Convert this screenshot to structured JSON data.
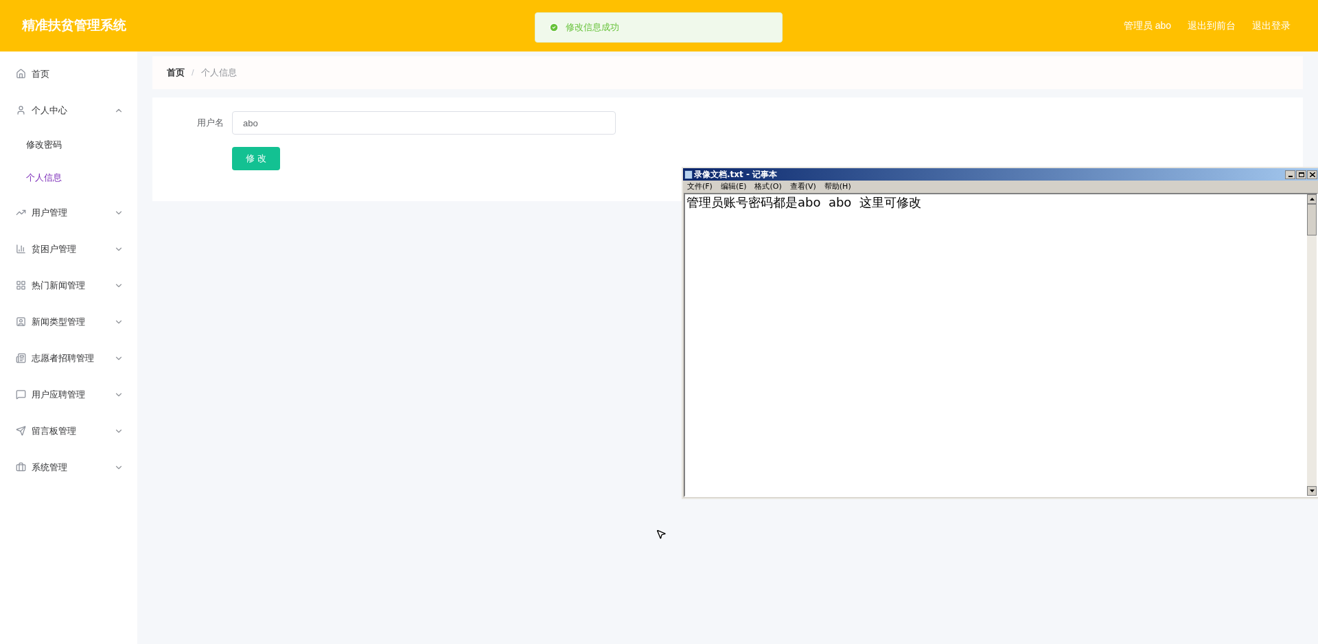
{
  "header": {
    "title": "精准扶贫管理系统",
    "links": [
      {
        "label": "管理员 abo"
      },
      {
        "label": "退出到前台"
      },
      {
        "label": "退出登录"
      }
    ]
  },
  "toast": {
    "message": "修改信息成功"
  },
  "sidebar": {
    "items": [
      {
        "label": "首页",
        "kind": "item"
      },
      {
        "label": "个人中心",
        "kind": "group",
        "expanded": true,
        "children": [
          {
            "label": "修改密码",
            "selected": false
          },
          {
            "label": "个人信息",
            "selected": true
          }
        ]
      },
      {
        "label": "用户管理",
        "kind": "group",
        "expanded": false
      },
      {
        "label": "贫困户管理",
        "kind": "group",
        "expanded": false
      },
      {
        "label": "热门新闻管理",
        "kind": "group",
        "expanded": false
      },
      {
        "label": "新闻类型管理",
        "kind": "group",
        "expanded": false
      },
      {
        "label": "志愿者招聘管理",
        "kind": "group",
        "expanded": false
      },
      {
        "label": "用户应聘管理",
        "kind": "group",
        "expanded": false
      },
      {
        "label": "留言板管理",
        "kind": "group",
        "expanded": false
      },
      {
        "label": "系统管理",
        "kind": "group",
        "expanded": false
      }
    ]
  },
  "breadcrumb": [
    "首页",
    "个人信息"
  ],
  "breadcrumb_separator": "/",
  "form": {
    "fields": [
      {
        "label": "用户名",
        "value": "abo"
      }
    ],
    "submit": "修 改"
  },
  "notepad": {
    "title": "录像文档.txt - 记事本",
    "menu": [
      "文件(F)",
      "编辑(E)",
      "格式(O)",
      "查看(V)",
      "帮助(H)"
    ],
    "text": "管理员账号密码都是abo  abo  这里可修改"
  }
}
